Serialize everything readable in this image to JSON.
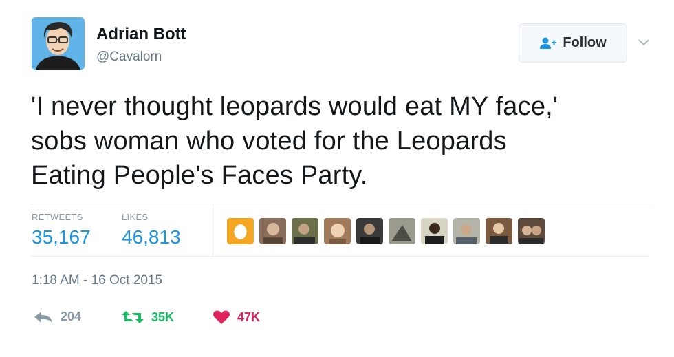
{
  "author": {
    "name": "Adrian Bott",
    "handle": "@Cavalorn"
  },
  "follow_button": {
    "label": "Follow",
    "icon": "follow-person-plus-icon"
  },
  "tweet": {
    "lines": [
      "'I never thought leopards would eat MY face,'",
      "sobs woman who voted for the Leopards",
      "Eating People's Faces Party."
    ]
  },
  "stats": {
    "retweets_label": "RETWEETS",
    "retweets_value": "35,167",
    "likes_label": "LIKES",
    "likes_value": "46,813"
  },
  "likers": [
    {
      "icon": "liker-avatar-orange-egg",
      "color": "#f5a623"
    },
    {
      "icon": "liker-avatar-photo",
      "color": "#8a6e5c"
    },
    {
      "icon": "liker-avatar-photo",
      "color": "#6b6f4a"
    },
    {
      "icon": "liker-avatar-photo",
      "color": "#a07a5a"
    },
    {
      "icon": "liker-avatar-photo",
      "color": "#3a3a3a"
    },
    {
      "icon": "liker-avatar-photo",
      "color": "#9a9a8e"
    },
    {
      "icon": "liker-avatar-photo",
      "color": "#4d4538"
    },
    {
      "icon": "liker-avatar-photo",
      "color": "#b4b4a8"
    },
    {
      "icon": "liker-avatar-photo",
      "color": "#7c5a40"
    },
    {
      "icon": "liker-avatar-photo",
      "color": "#5e4b3e"
    }
  ],
  "timestamp": "1:18 AM - 16 Oct 2015",
  "actions": {
    "reply_count": "204",
    "retweet_count": "35K",
    "like_count": "47K"
  },
  "colors": {
    "link_blue": "#1b95e0",
    "retweet_green": "#17bf63",
    "like_red": "#e0245e",
    "muted_gray": "#657786"
  }
}
